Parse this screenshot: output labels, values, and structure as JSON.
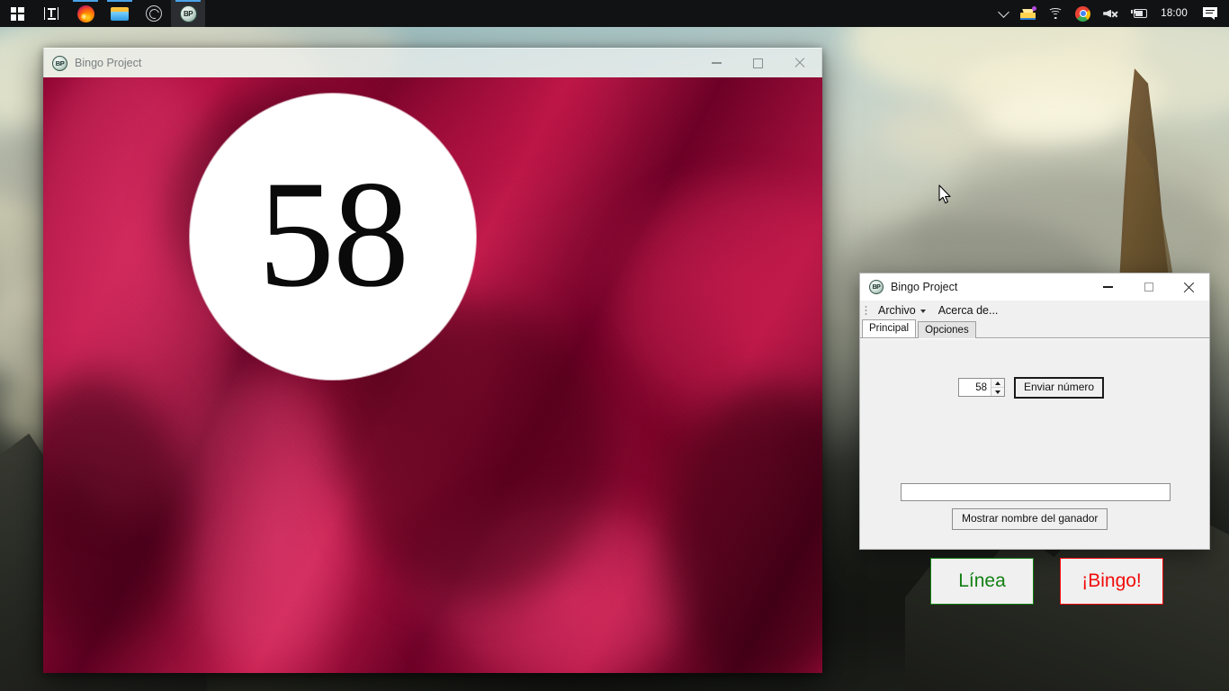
{
  "taskbar": {
    "items": [
      {
        "name": "start-button",
        "icon": "windows-logo-icon",
        "label": "Start"
      },
      {
        "name": "task-view-button",
        "icon": "task-view-icon",
        "label": "Task View"
      },
      {
        "name": "taskbar-firefox",
        "icon": "firefox-icon",
        "label": "Firefox"
      },
      {
        "name": "taskbar-file-explorer",
        "icon": "file-explorer-icon",
        "label": "File Explorer"
      },
      {
        "name": "taskbar-obs",
        "icon": "obs-studio-icon",
        "label": "OBS Studio"
      },
      {
        "name": "taskbar-bingo-project",
        "icon": "bingo-project-icon",
        "label": "Bingo Project",
        "badge": "BP"
      }
    ],
    "tray": {
      "chevron": "chevron-up-icon",
      "icons": [
        "tray-inbox-icon",
        "wifi-icon",
        "chrome-icon",
        "speaker-muted-icon",
        "battery-charging-icon"
      ],
      "clock": "18:00",
      "notifications": "action-center-icon"
    }
  },
  "main_window": {
    "title": "Bingo Project",
    "app_badge": "BP",
    "controls": {
      "minimize": "minimize-icon",
      "maximize": "maximize-icon",
      "close": "close-icon"
    },
    "drawn_number": "58"
  },
  "dialog": {
    "title": "Bingo Project",
    "app_badge": "BP",
    "controls": {
      "minimize": "minimize-icon",
      "maximize": "maximize-icon",
      "close": "close-icon"
    },
    "menu": [
      {
        "label": "Archivo",
        "has_caret": true
      },
      {
        "label": "Acerca de...",
        "has_caret": false
      }
    ],
    "tabs": [
      {
        "label": "Principal",
        "active": true
      },
      {
        "label": "Opciones",
        "active": false
      }
    ],
    "number_spinner": {
      "value": "58"
    },
    "send_button": "Enviar número",
    "winner_input": {
      "value": "",
      "placeholder": ""
    },
    "winner_button": "Mostrar nombre del ganador",
    "line_button": "Línea",
    "bingo_button": "¡Bingo!",
    "colors": {
      "line_green": "#138013",
      "bingo_red": "#f20b0b",
      "dialog_bg": "#f0f0f0",
      "accent_blue": "#4aa3e8"
    }
  }
}
